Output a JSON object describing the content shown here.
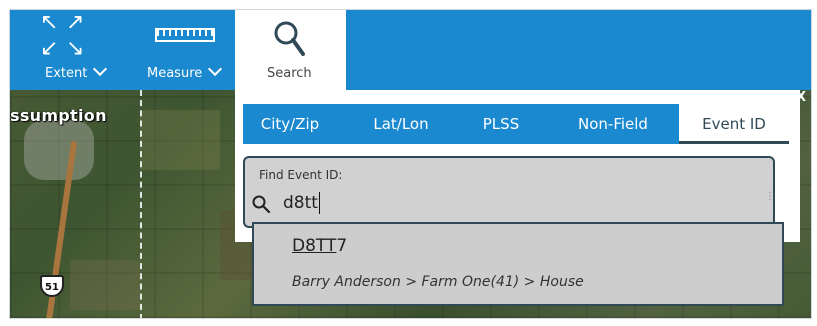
{
  "map": {
    "place_label": "ssumption",
    "route_shield": "51"
  },
  "toolbar": {
    "extent_label": "Extent",
    "measure_label": "Measure",
    "search_label": "Search"
  },
  "search_panel": {
    "close_label": "X",
    "tabs": [
      {
        "label": "City/Zip",
        "active": false
      },
      {
        "label": "Lat/Lon",
        "active": false
      },
      {
        "label": "PLSS",
        "active": false
      },
      {
        "label": "Non-Field",
        "active": false
      },
      {
        "label": "Event ID",
        "active": true
      }
    ],
    "input_label": "Find Event ID:",
    "input_value": "d8tt"
  },
  "dropdown": {
    "result_match": "D8TT",
    "result_rest": "7",
    "result_path": "Barry Anderson > Farm One(41) > House"
  },
  "colors": {
    "toolbar_blue": "#1a89cf",
    "dark_accent": "#2f4a56",
    "input_bg": "#d1d1d1"
  }
}
